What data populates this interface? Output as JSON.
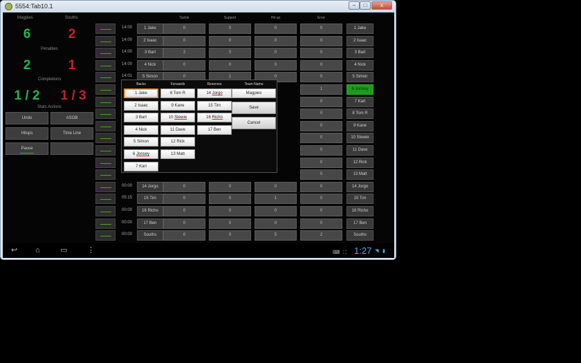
{
  "window": {
    "title": "5554:Tab10.1",
    "min": "–",
    "max": "□",
    "close": "x"
  },
  "stats": {
    "team_home": "Magpies",
    "team_away": "Souths",
    "score_home": "6",
    "score_away": "2",
    "penalties_label": "Penalties",
    "pen_home": "2",
    "pen_away": "1",
    "completions_label": "Completions",
    "comp_home": "1 / 2",
    "comp_away": "1 / 3",
    "actions_label": "Stats Actions",
    "buttons": [
      "Undo",
      "ASOB",
      "Hitups",
      "Time Line",
      "Pause",
      ""
    ]
  },
  "columns": [
    "Tackle",
    "Support",
    "Hit-up",
    "Error"
  ],
  "rows": [
    {
      "time": "14:00",
      "name": "1 Jake",
      "vals": [
        "0",
        "0",
        "0",
        "0"
      ],
      "right": "1 Jake"
    },
    {
      "time": "14:00",
      "name": "2 Isaac",
      "vals": [
        "0",
        "0",
        "0",
        "0"
      ],
      "right": "2 Isaac"
    },
    {
      "time": "14:00",
      "name": "3 Bart",
      "vals": [
        "2",
        "0",
        "0",
        "0"
      ],
      "right": "3 Bart"
    },
    {
      "time": "14:00",
      "name": "4 Nick",
      "vals": [
        "0",
        "0",
        "0",
        "0"
      ],
      "right": "4 Nick"
    },
    {
      "time": "14:01",
      "name": "5 Simon",
      "vals": [
        "0",
        "1",
        "0",
        "0"
      ],
      "right": "5 Simon"
    },
    {
      "time": "",
      "name": "",
      "vals": [
        "",
        "",
        "",
        "1"
      ],
      "right": "6 Jonsey"
    },
    {
      "time": "",
      "name": "",
      "vals": [
        "",
        "",
        "",
        "0"
      ],
      "right": "7 Karl"
    },
    {
      "time": "",
      "name": "",
      "vals": [
        "",
        "",
        "",
        "0"
      ],
      "right": "8 Tom R"
    },
    {
      "time": "",
      "name": "",
      "vals": [
        "",
        "",
        "",
        "0"
      ],
      "right": "9 Kane"
    },
    {
      "time": "",
      "name": "",
      "vals": [
        "",
        "",
        "",
        "0"
      ],
      "right": "10 Stewie"
    },
    {
      "time": "",
      "name": "",
      "vals": [
        "",
        "",
        "",
        "0"
      ],
      "right": "11 Dave"
    },
    {
      "time": "",
      "name": "",
      "vals": [
        "",
        "",
        "",
        "0"
      ],
      "right": "12 Rick"
    },
    {
      "time": "",
      "name": "",
      "vals": [
        "",
        "",
        "",
        "0"
      ],
      "right": "13 Matt"
    },
    {
      "time": "00:00",
      "name": "14 Jorgo",
      "vals": [
        "0",
        "0",
        "0",
        "0"
      ],
      "right": "14 Jorgo"
    },
    {
      "time": "05:15",
      "name": "15 Tim",
      "vals": [
        "0",
        "0",
        "1",
        "0"
      ],
      "right": "15 Tim"
    },
    {
      "time": "00:00",
      "name": "16 Richo",
      "vals": [
        "0",
        "0",
        "0",
        "0"
      ],
      "right": "16 Richo"
    },
    {
      "time": "00:00",
      "name": "17 Ben",
      "vals": [
        "0",
        "0",
        "0",
        "0"
      ],
      "right": "17 Ben"
    },
    {
      "time": "00:00",
      "name": "Souths",
      "vals": [
        "0",
        "0",
        "5",
        "2"
      ],
      "right": "Souths"
    }
  ],
  "dialog": {
    "headers": [
      "Backs",
      "Forwards",
      "Reserves",
      "Team Name"
    ],
    "backs": [
      "1 Jake",
      "2 Isaac",
      "3 Bart",
      "4 Nick",
      "5 Simon",
      "6 Jonsey",
      "7 Karl"
    ],
    "forwards": [
      "8 Tom R",
      "9 Kane",
      "10 Stewie",
      "11 Dave",
      "12 Rick",
      "13 Matt"
    ],
    "reserves": [
      "14 Jorgo",
      "15 Tim",
      "16 Richo",
      "17 Ben"
    ],
    "team_name": "Magpies",
    "save": "Save",
    "cancel": "Cancel"
  },
  "nav": {
    "back": "↩",
    "home": "⌂",
    "recent": "▭",
    "menu": "⋮",
    "time": "1:27"
  },
  "colors": {
    "green": "#27b54a",
    "red": "#c8202a",
    "selected": "#1f9a1f",
    "clock": "#4ab0e0"
  }
}
